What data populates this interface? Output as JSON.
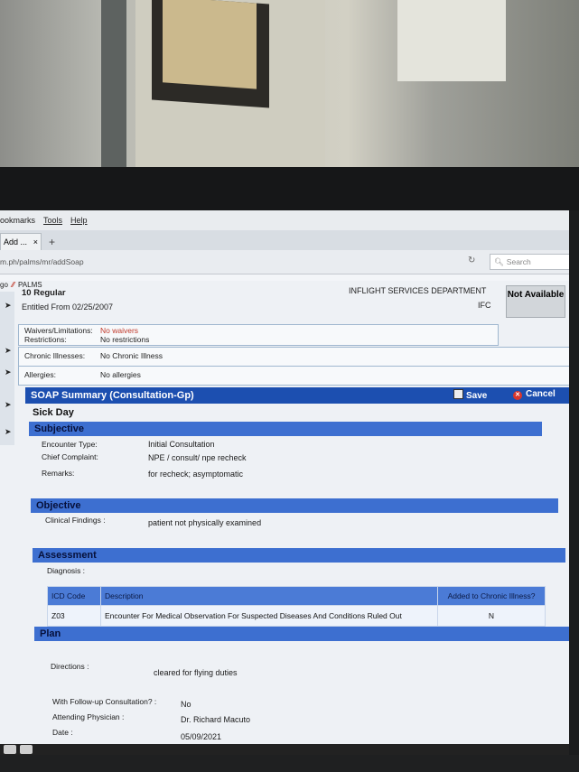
{
  "browser": {
    "menu": [
      "ookmarks",
      "Tools",
      "Help"
    ],
    "tab_label": "Add ...",
    "tab_close": "×",
    "new_tab": "+",
    "url": "m.ph/palms/mr/addSoap",
    "search_placeholder": "Search"
  },
  "app": {
    "brand": "PALMS",
    "brand_prefix": "go",
    "header": {
      "regular": "10 Regular",
      "entitled": "Entitled From 02/25/2007",
      "department": "INFLIGHT SERVICES DEPARTMENT",
      "base": "IFC",
      "availability": "Not Available"
    },
    "waivers_label": "Waivers/Limitations:",
    "waivers_value": "No waivers",
    "restrictions_label": "Restrictions:",
    "restrictions_value": "No restrictions",
    "chronic_label": "Chronic Illnesses:",
    "chronic_value": "No Chronic Illness",
    "allergies_label": "Allergies:",
    "allergies_value": "No allergies"
  },
  "soap": {
    "title": "SOAP Summary (Consultation-Gp)",
    "save_label": "Save",
    "cancel_label": "Cancel",
    "disposition": "Sick Day",
    "subjective": {
      "heading": "Subjective",
      "encounter_type_label": "Encounter Type:",
      "encounter_type_value": "Initial Consultation",
      "chief_complaint_label": "Chief Complaint:",
      "chief_complaint_value": "NPE / consult/ npe recheck",
      "remarks_label": "Remarks:",
      "remarks_value": "for recheck; asymptomatic"
    },
    "objective": {
      "heading": "Objective",
      "clinical_findings_label": "Clinical Findings :",
      "clinical_findings_value": "patient not physically examined"
    },
    "assessment": {
      "heading": "Assessment",
      "diagnosis_label": "Diagnosis :",
      "columns": [
        "ICD Code",
        "Description",
        "Added to Chronic Illness?"
      ],
      "rows": [
        {
          "icd": "Z03",
          "description": "Encounter For Medical Observation For Suspected Diseases And Conditions Ruled Out",
          "chronic": "N"
        }
      ]
    },
    "plan": {
      "heading": "Plan",
      "directions_label": "Directions :",
      "directions_value": "cleared for flying duties",
      "followup_label": "With Follow-up Consultation? :",
      "followup_value": "No",
      "physician_label": "Attending Physician :",
      "physician_value": "Dr. Richard Macuto",
      "date_label": "Date :",
      "date_value": "05/09/2021"
    }
  },
  "colors": {
    "title_bar": "#1c4fb0",
    "section_bar": "#3d6fd0",
    "waiver_red": "#c0392b",
    "cancel_red": "#d9362c"
  }
}
